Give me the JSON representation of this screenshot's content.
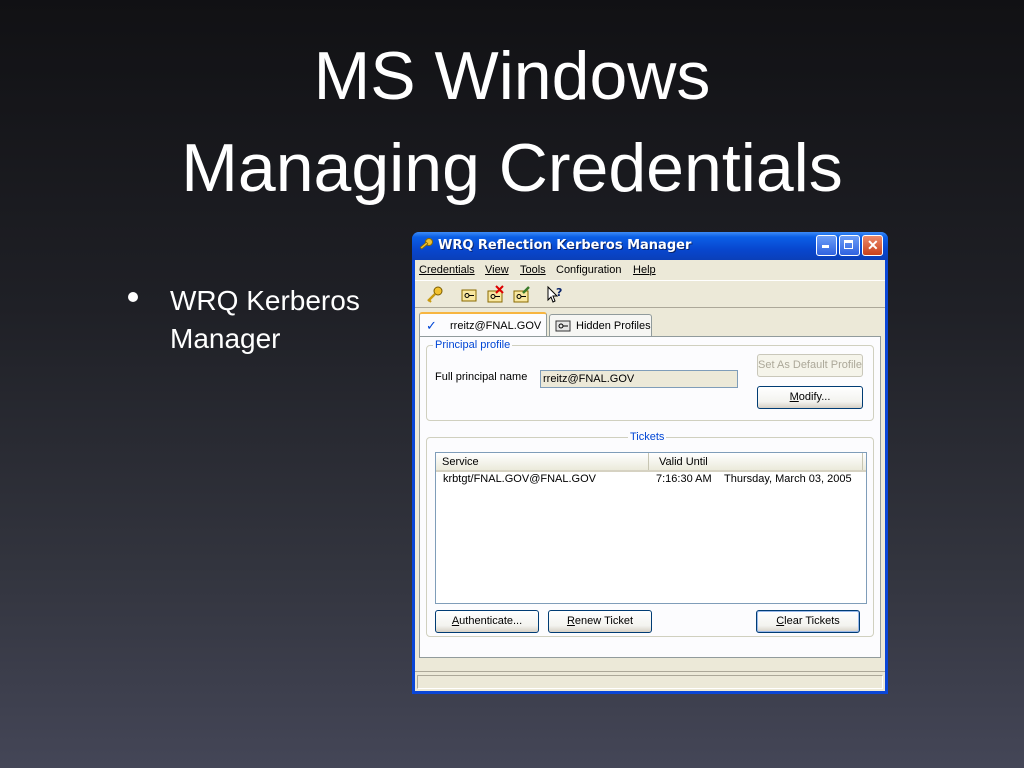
{
  "slide": {
    "title_line1": "MS Windows",
    "title_line2": "Managing Credentials",
    "bullets": [
      {
        "text": "WRQ Kerberos Manager"
      }
    ]
  },
  "window": {
    "title": "WRQ Reflection Kerberos Manager",
    "title_icon": "key-icon",
    "controls": {
      "minimize": "_",
      "maximize": "□",
      "close": "✕"
    },
    "menu": [
      {
        "key": "C",
        "rest": "redentials"
      },
      {
        "key": "V",
        "rest": "iew"
      },
      {
        "key": "T",
        "rest": "ools"
      },
      {
        "key": "",
        "rest": "Configuration"
      },
      {
        "key": "H",
        "rest": "elp"
      }
    ],
    "toolbar_icons": [
      "key-icon",
      "credential-card-icon",
      "delete-credential-icon",
      "edit-credential-icon",
      "context-help-icon"
    ],
    "tabs": [
      {
        "label": "rreitz@FNAL.GOV",
        "check": "✓",
        "active": true
      },
      {
        "label": "Hidden Profiles",
        "active": false
      }
    ],
    "principal_profile": {
      "legend": "Principal profile",
      "full_name_label": "Full principal name",
      "full_name_value": "rreitz@FNAL.GOV",
      "set_default_label": "Set As Default Profile",
      "modify_label_key": "M",
      "modify_label_rest": "odify..."
    },
    "tickets": {
      "legend": "Tickets",
      "columns": [
        "Service",
        "Valid Until"
      ],
      "rows": [
        {
          "service": "krbtgt/FNAL.GOV@FNAL.GOV",
          "time": "7:16:30 AM",
          "date": "Thursday, March 03, 2005"
        }
      ],
      "authenticate_key": "A",
      "authenticate_rest": "uthenticate...",
      "renew_key": "R",
      "renew_rest": "enew Ticket",
      "clear_key": "C",
      "clear_rest": "lear Tickets"
    },
    "status_text": ""
  },
  "colors": {
    "title_blue": "#0a46d6",
    "group_legend": "#0046d5",
    "tab_highlight": "#f7b540"
  }
}
